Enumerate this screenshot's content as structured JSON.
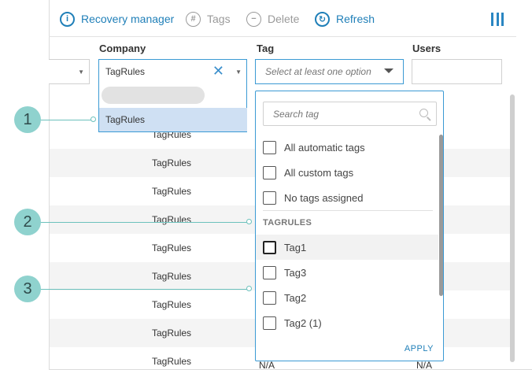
{
  "toolbar": {
    "recovery_label": "Recovery manager",
    "tags_label": "Tags",
    "delete_label": "Delete",
    "refresh_label": "Refresh"
  },
  "columns": {
    "company": "Company",
    "tag": "Tag",
    "users": "Users"
  },
  "filters": {
    "company_value": "TagRules",
    "tag_placeholder": "Select at least one option"
  },
  "company_dropdown": {
    "option": "TagRules"
  },
  "rows": [
    {
      "company": "TagRules"
    },
    {
      "company": "TagRules"
    },
    {
      "company": "TagRules"
    },
    {
      "company": "TagRules"
    },
    {
      "company": "TagRules"
    },
    {
      "company": "TagRules"
    },
    {
      "company": "TagRules"
    },
    {
      "company": "TagRules"
    },
    {
      "company": "TagRules",
      "tag": "N/A",
      "users": "N/A"
    }
  ],
  "tag_dropdown": {
    "search_placeholder": "Search tag",
    "options": [
      "All automatic tags",
      "All custom tags",
      "No tags assigned"
    ],
    "group_label": "TAGRULES",
    "tags": [
      "Tag1",
      "Tag3",
      "Tag2",
      "Tag2 (1)"
    ],
    "apply_label": "APPLY"
  },
  "callouts": [
    "1",
    "2",
    "3"
  ],
  "colors": {
    "accent": "#1f7fb8",
    "callout": "#8fd2ce",
    "selected": "#cfe0f3"
  }
}
